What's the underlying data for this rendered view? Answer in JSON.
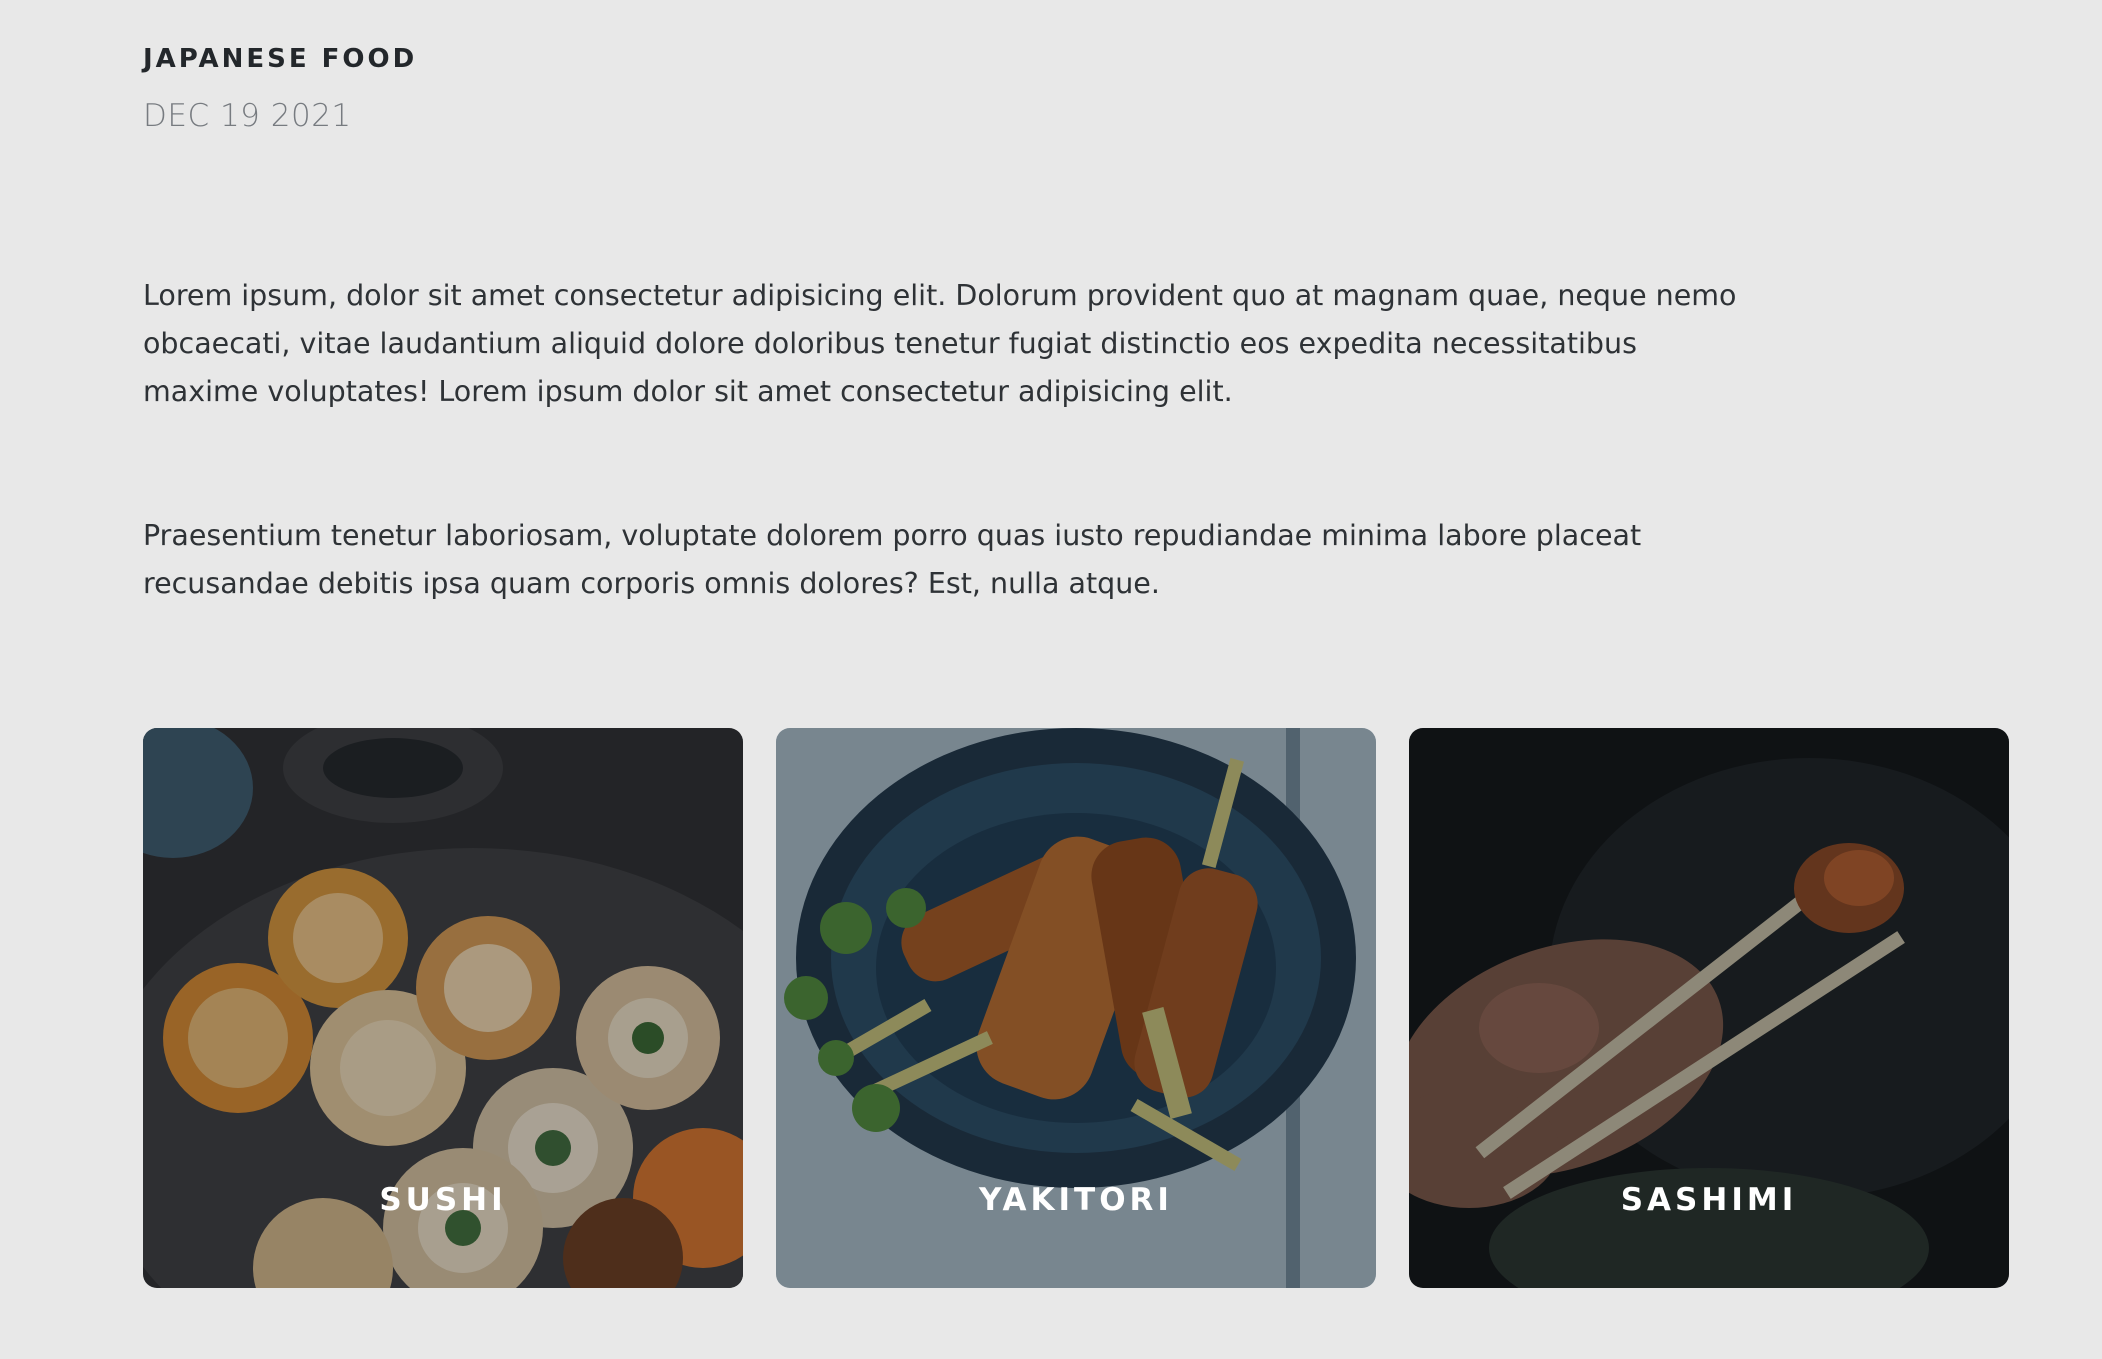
{
  "article": {
    "title": "JAPANESE FOOD",
    "date": "DEC 19 2021",
    "paragraphs": [
      "Lorem ipsum, dolor sit amet consectetur adipisicing elit. Dolorum provident quo at magnam quae, neque nemo obcaecati, vitae laudantium aliquid dolore doloribus tenetur fugiat distinctio eos expedita necessitatibus maxime voluptates! Lorem ipsum dolor sit amet consectetur adipisicing elit.",
      "Praesentium tenetur laboriosam, voluptate dolorem porro quas iusto repudiandae minima labore placeat recusandae debitis ipsa quam corporis omnis dolores? Est, nulla atque."
    ]
  },
  "cards": [
    {
      "label": "SUSHI"
    },
    {
      "label": "YAKITORI"
    },
    {
      "label": "SASHIMI"
    }
  ]
}
